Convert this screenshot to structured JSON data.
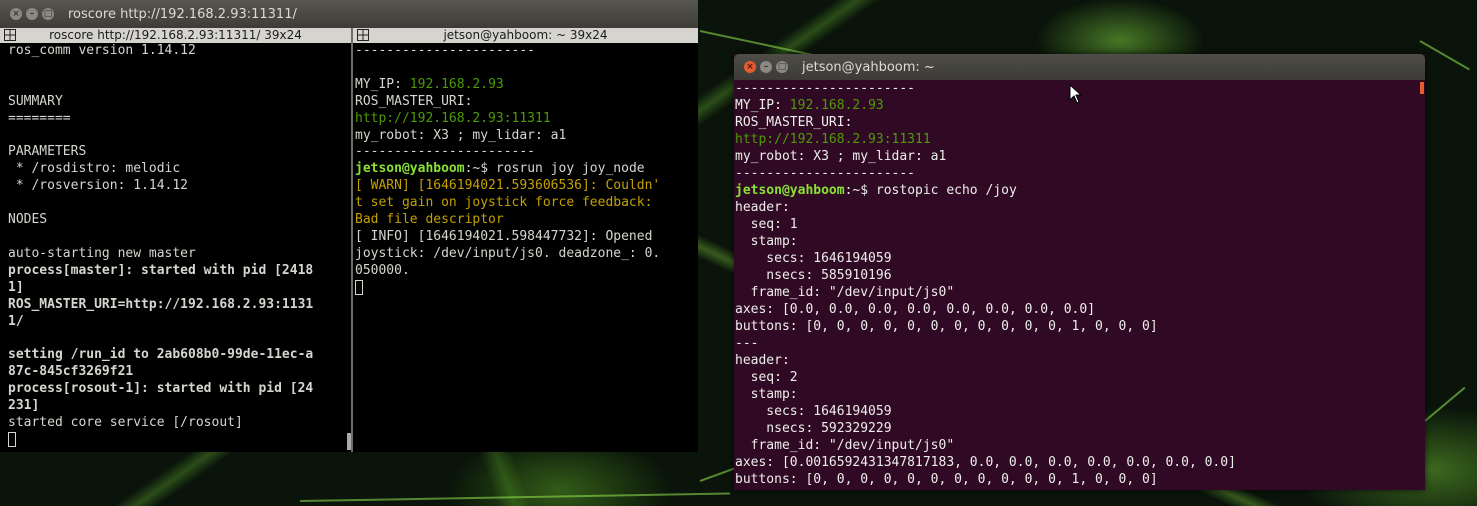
{
  "left_window": {
    "title": "roscore http://192.168.2.93:11311/",
    "left_pane": {
      "header": "roscore http://192.168.2.93:11311/ 39x24",
      "lines": [
        {
          "t": "ros_comm version 1.14.12"
        },
        {
          "t": ""
        },
        {
          "t": ""
        },
        {
          "t": "SUMMARY"
        },
        {
          "t": "========"
        },
        {
          "t": ""
        },
        {
          "t": "PARAMETERS"
        },
        {
          "t": " * /rosdistro: melodic"
        },
        {
          "t": " * /rosversion: 1.14.12"
        },
        {
          "t": ""
        },
        {
          "t": "NODES"
        },
        {
          "t": ""
        },
        {
          "t": "auto-starting new master"
        },
        {
          "t": "process[master]: started with pid [2418",
          "b": true
        },
        {
          "t": "1]",
          "b": true
        },
        {
          "t": "ROS_MASTER_URI=http://192.168.2.93:1131",
          "b": true
        },
        {
          "t": "1/",
          "b": true
        },
        {
          "t": ""
        },
        {
          "t": "setting /run_id to 2ab608b0-99de-11ec-a",
          "b": true
        },
        {
          "t": "87c-845cf3269f21",
          "b": true
        },
        {
          "t": "process[rosout-1]: started with pid [24",
          "b": true
        },
        {
          "t": "231]",
          "b": true
        },
        {
          "t": "started core service [/rosout]"
        }
      ]
    },
    "right_pane": {
      "header": "jetson@yahboom: ~ 39x24",
      "lines": [
        {
          "t": "-----------------------"
        },
        {
          "t": ""
        },
        {
          "t": "MY_IP: ",
          "v": "192.168.2.93"
        },
        {
          "t": "ROS_MASTER_URI:"
        },
        {
          "t": "",
          "v": "http://192.168.2.93:11311"
        },
        {
          "t": "my_robot: X3 ; my_lidar: a1"
        },
        {
          "t": "-----------------------"
        },
        {
          "p": "jetson@yahboom",
          "t": ":~$ rosrun joy joy_node"
        },
        {
          "t": "[ WARN] [1646194021.593606536]: Couldn'",
          "y": true
        },
        {
          "t": "t set gain on joystick force feedback:",
          "y": true
        },
        {
          "t": "Bad file descriptor",
          "y": true
        },
        {
          "t": "[ INFO] [1646194021.598447732]: Opened"
        },
        {
          "t": "joystick: /dev/input/js0. deadzone_: 0."
        },
        {
          "t": "050000."
        }
      ]
    }
  },
  "right_window": {
    "title": "jetson@yahboom: ~",
    "lines": [
      {
        "t": "-----------------------"
      },
      {
        "t": "MY_IP: ",
        "v": "192.168.2.93"
      },
      {
        "t": "ROS_MASTER_URI:"
      },
      {
        "t": "",
        "v": "http://192.168.2.93:11311"
      },
      {
        "t": "my_robot: X3 ; my_lidar: a1"
      },
      {
        "t": "-----------------------"
      },
      {
        "p": "jetson@yahboom",
        "t": ":~$ rostopic echo /joy"
      },
      {
        "t": "header:"
      },
      {
        "t": "  seq: 1"
      },
      {
        "t": "  stamp:"
      },
      {
        "t": "    secs: 1646194059"
      },
      {
        "t": "    nsecs: 585910196"
      },
      {
        "t": "  frame_id: \"/dev/input/js0\""
      },
      {
        "t": "axes: [0.0, 0.0, 0.0, 0.0, 0.0, 0.0, 0.0, 0.0]"
      },
      {
        "t": "buttons: [0, 0, 0, 0, 0, 0, 0, 0, 0, 0, 0, 1, 0, 0, 0]"
      },
      {
        "t": "---"
      },
      {
        "t": "header:"
      },
      {
        "t": "  seq: 2"
      },
      {
        "t": "  stamp:"
      },
      {
        "t": "    secs: 1646194059"
      },
      {
        "t": "    nsecs: 592329229"
      },
      {
        "t": "  frame_id: \"/dev/input/js0\""
      },
      {
        "t": "axes: [0.0016592431347817183, 0.0, 0.0, 0.0, 0.0, 0.0, 0.0, 0.0]"
      },
      {
        "t": "buttons: [0, 0, 0, 0, 0, 0, 0, 0, 0, 0, 0, 1, 0, 0, 0]"
      }
    ]
  },
  "colors": {
    "ubuntu_terminal_bg": "#300a24",
    "prompt_green": "#8ae234",
    "value_green": "#4e9a06",
    "warn_yellow": "#c4a000",
    "close_orange": "#e35b2e"
  }
}
